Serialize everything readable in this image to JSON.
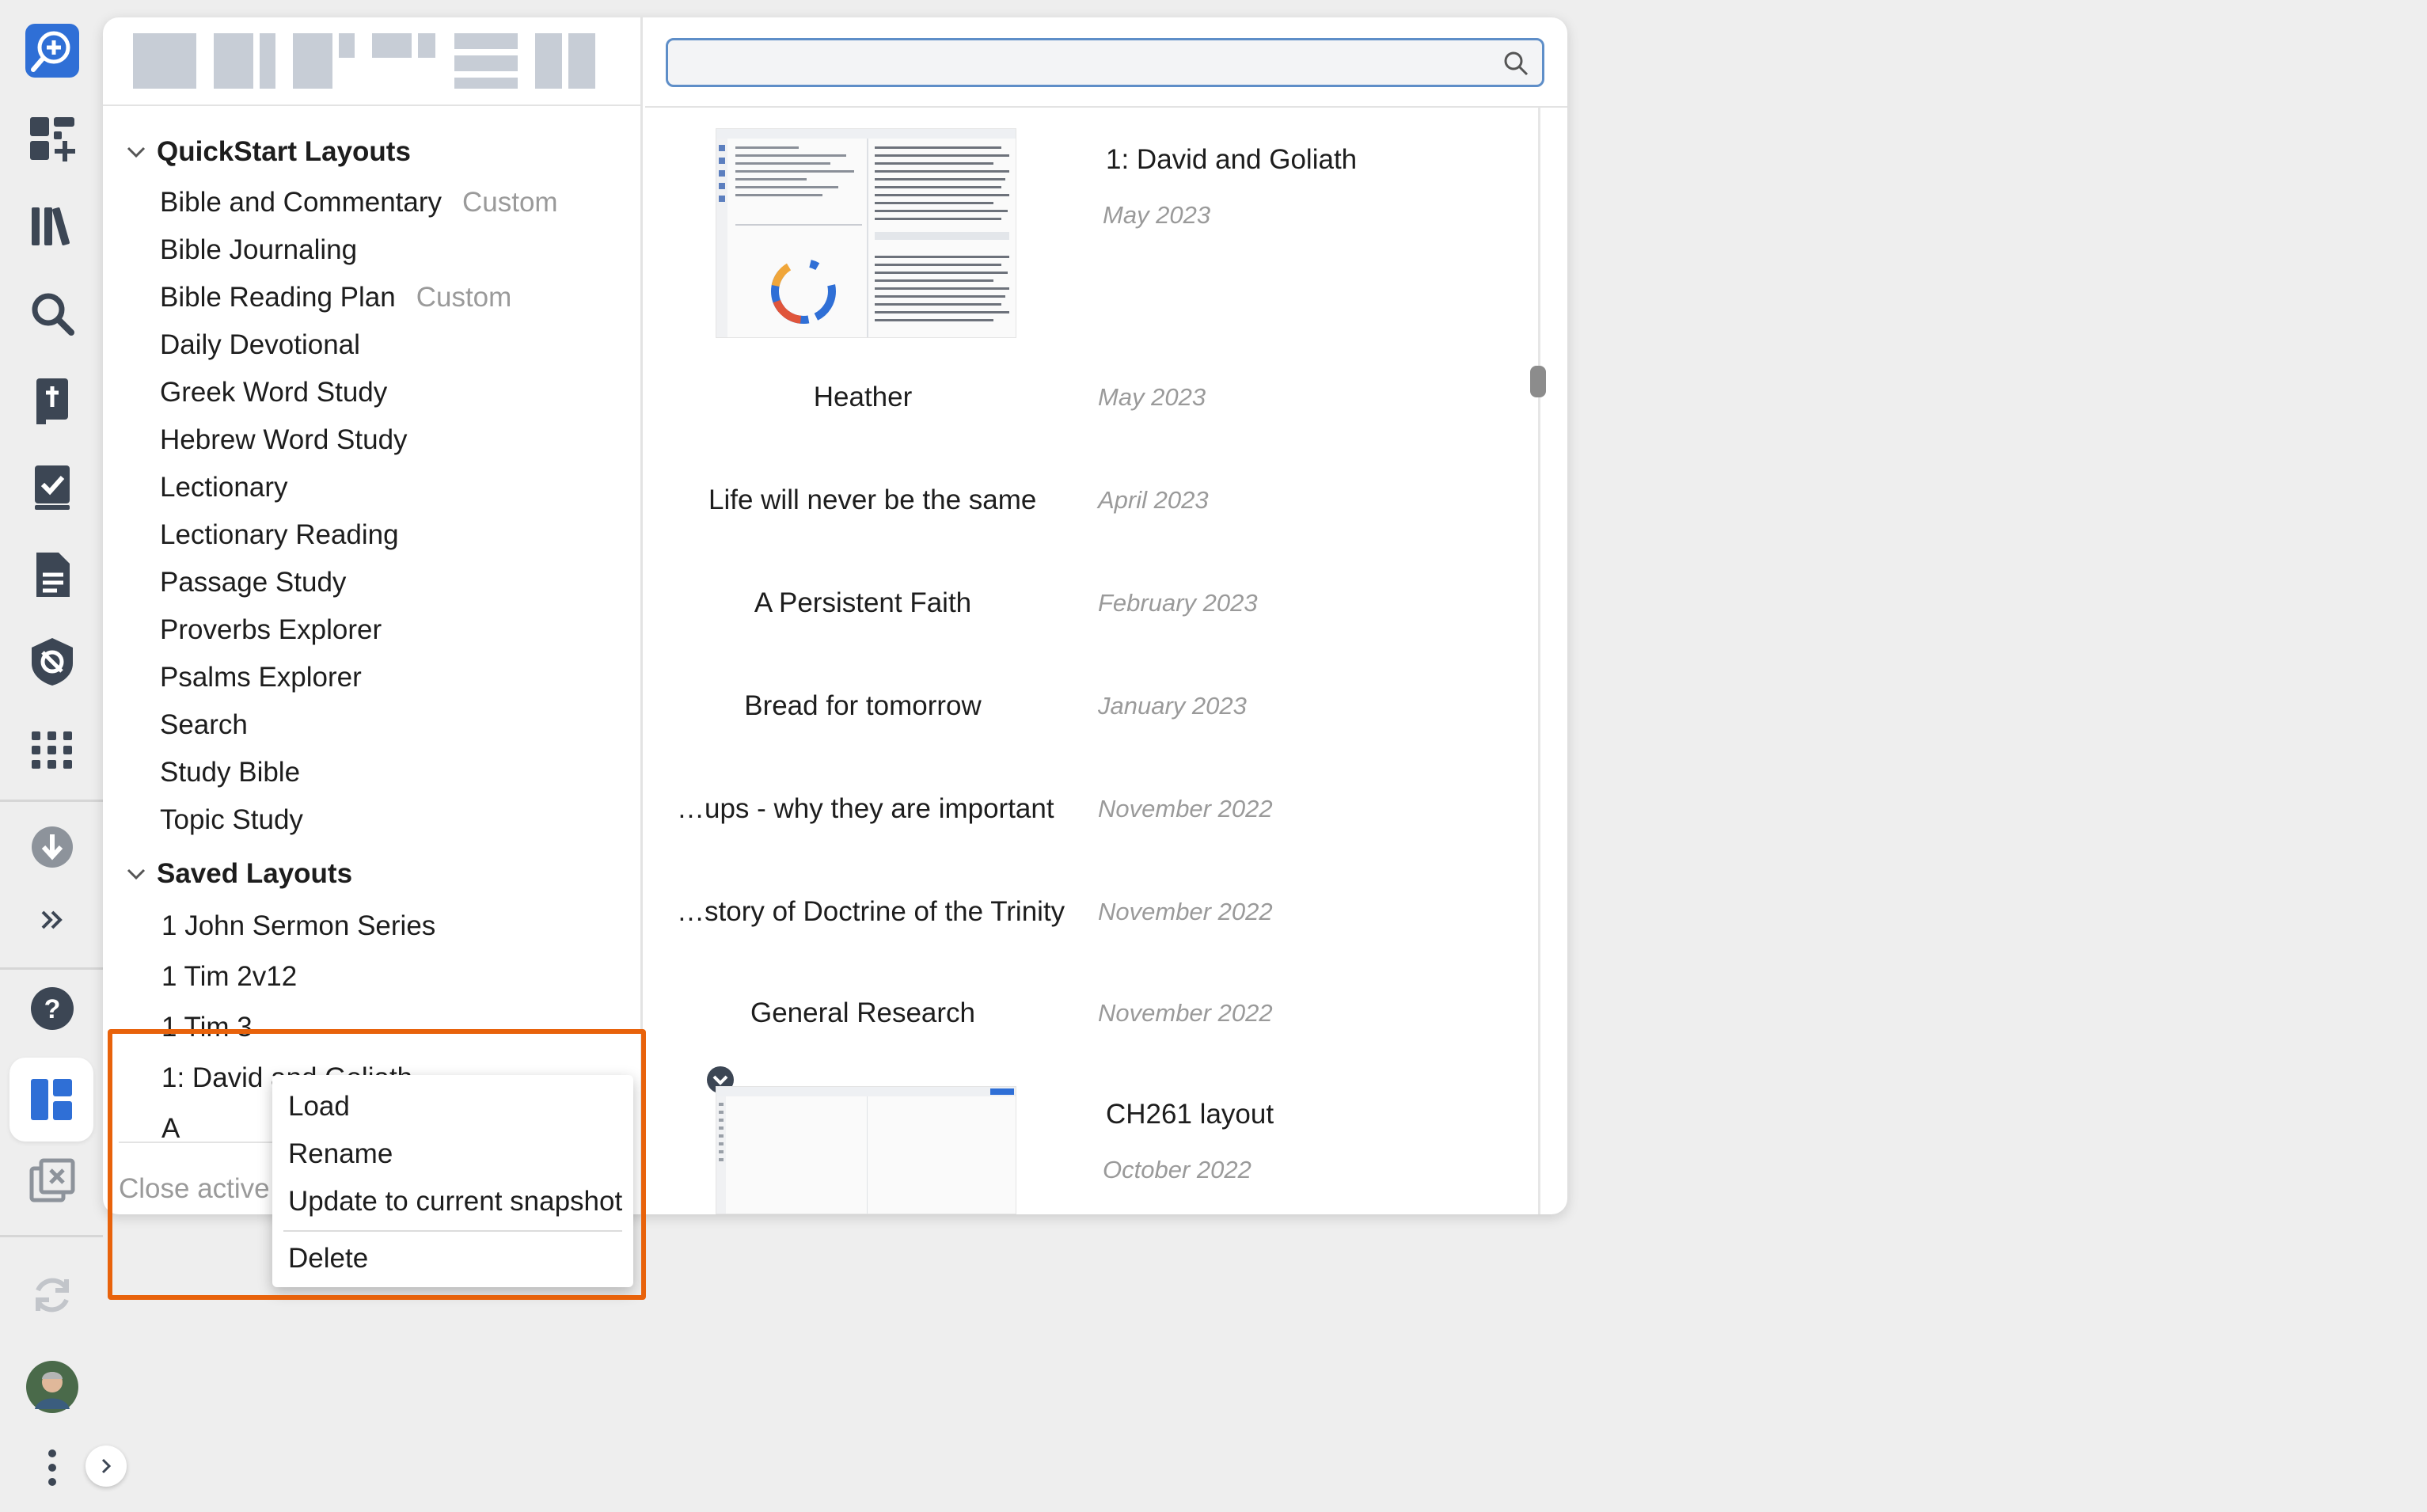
{
  "rail": {
    "top_icons": [
      "new-search-icon",
      "add-panel-icon",
      "library-icon",
      "search-icon",
      "bible-icon",
      "checklist-icon",
      "document-icon",
      "shield-icon",
      "apps-grid-icon"
    ],
    "mid_icons": [
      "download-icon",
      "expand-more-icon"
    ],
    "bottom_icons": [
      "help-icon",
      "layouts-icon",
      "close-panels-icon",
      "sync-icon"
    ],
    "active": "layouts-icon"
  },
  "layout_picker": {
    "quickstart_header": "QuickStart Layouts",
    "quickstart_items": [
      {
        "label": "Bible and Commentary",
        "tag": "Custom"
      },
      {
        "label": "Bible Journaling",
        "tag": ""
      },
      {
        "label": "Bible Reading Plan",
        "tag": "Custom"
      },
      {
        "label": "Daily Devotional",
        "tag": ""
      },
      {
        "label": "Greek Word Study",
        "tag": ""
      },
      {
        "label": "Hebrew Word Study",
        "tag": ""
      },
      {
        "label": "Lectionary",
        "tag": ""
      },
      {
        "label": "Lectionary Reading",
        "tag": ""
      },
      {
        "label": "Passage Study",
        "tag": ""
      },
      {
        "label": "Proverbs Explorer",
        "tag": ""
      },
      {
        "label": "Psalms Explorer",
        "tag": ""
      },
      {
        "label": "Search",
        "tag": ""
      },
      {
        "label": "Study Bible",
        "tag": ""
      },
      {
        "label": "Topic Study",
        "tag": ""
      }
    ],
    "saved_header": "Saved Layouts",
    "saved_items": [
      "1 John Sermon Series",
      "1 Tim 2v12",
      "1 Tim 3",
      "1: David and Goliath",
      "A"
    ],
    "close_active": "Close active l"
  },
  "search": {
    "placeholder": "",
    "value": ""
  },
  "recent_layouts": [
    {
      "name": "1: David and Goliath",
      "date": "May 2023"
    },
    {
      "name": "Heather",
      "date": "May 2023"
    },
    {
      "name": "Life will never be the same",
      "date": "April 2023"
    },
    {
      "name": "A Persistent Faith",
      "date": "February 2023"
    },
    {
      "name": "Bread for tomorrow",
      "date": "January 2023"
    },
    {
      "name": "…ups - why they are important",
      "date": "November 2022"
    },
    {
      "name": "…story of Doctrine of the Trinity",
      "date": "November 2022"
    },
    {
      "name": "General Research",
      "date": "November 2022"
    },
    {
      "name": "CH261 layout",
      "date": "October 2022"
    }
  ],
  "context_menu": {
    "load": "Load",
    "rename": "Rename",
    "update": "Update to current snapshot",
    "delete": "Delete"
  },
  "colors": {
    "accent": "#2f6fd6",
    "highlight": "#e8620b",
    "rail_icon": "#3c4654"
  }
}
